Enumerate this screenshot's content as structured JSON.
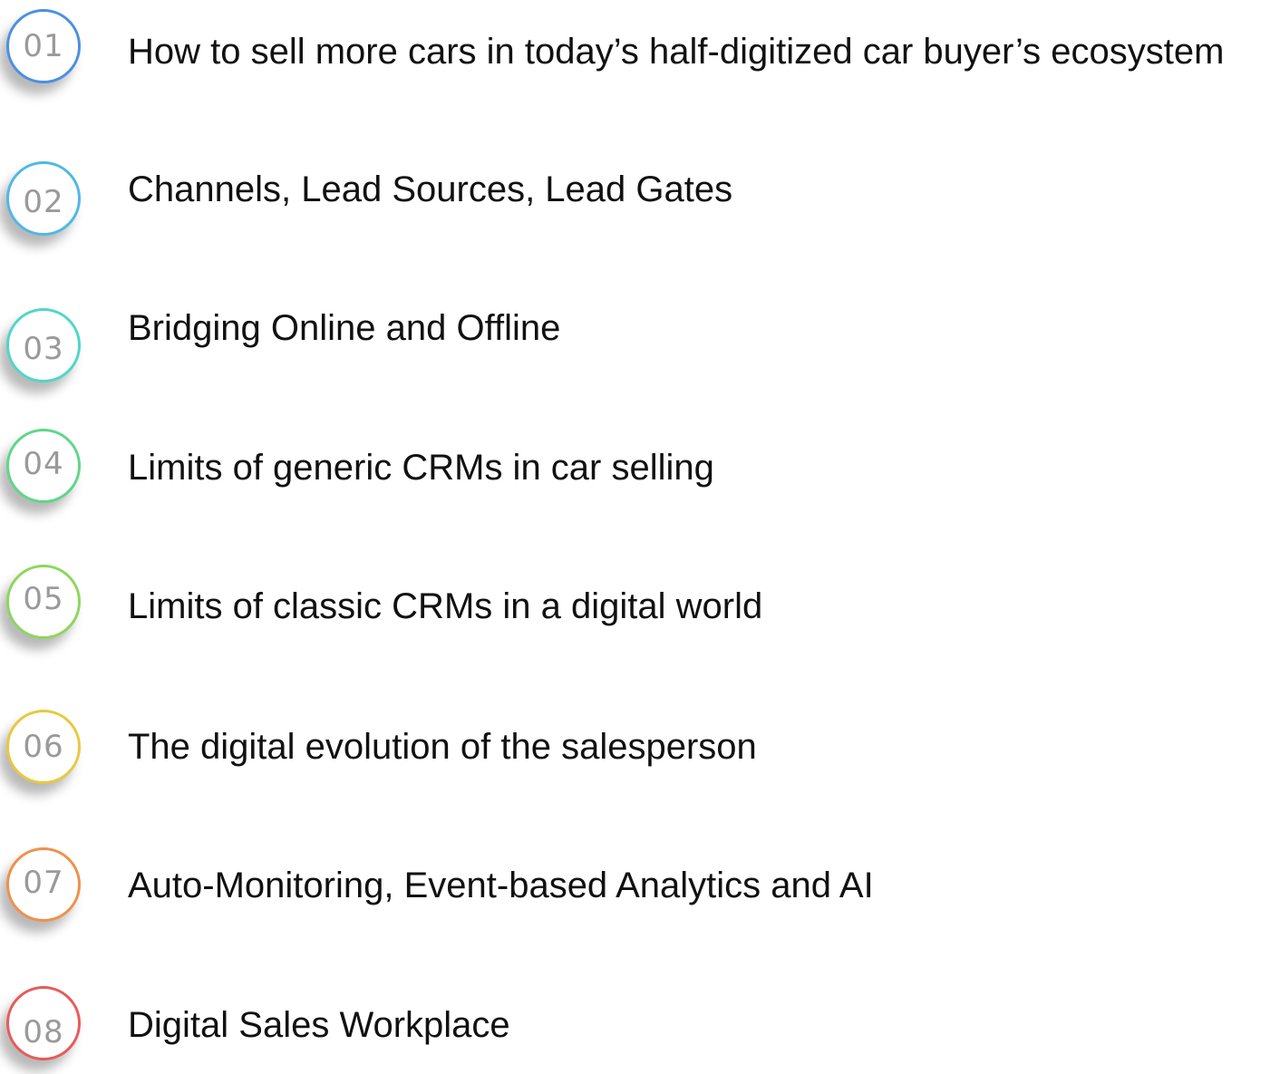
{
  "agenda": {
    "items": [
      {
        "number": "01",
        "title": "How to sell more cars in today’s half-digitized car buyer’s ecosystem",
        "ring_color": "#4a90e2"
      },
      {
        "number": "02",
        "title": "Channels, Lead Sources, Lead Gates",
        "ring_color": "#4fb8e6"
      },
      {
        "number": "03",
        "title": "Bridging Online and Offline",
        "ring_color": "#4fd6c8"
      },
      {
        "number": "04",
        "title": "Limits of generic CRMs in car selling",
        "ring_color": "#5ed68a"
      },
      {
        "number": "05",
        "title": "Limits of classic CRMs in a digital world",
        "ring_color": "#8ed65e"
      },
      {
        "number": "06",
        "title": "The digital evolution of the salesperson",
        "ring_color": "#e8c840"
      },
      {
        "number": "07",
        "title": "Auto-Monitoring, Event-based Analytics and AI",
        "ring_color": "#f0904a"
      },
      {
        "number": "08",
        "title": "Digital Sales Workplace",
        "ring_color": "#e85a5a"
      }
    ]
  }
}
